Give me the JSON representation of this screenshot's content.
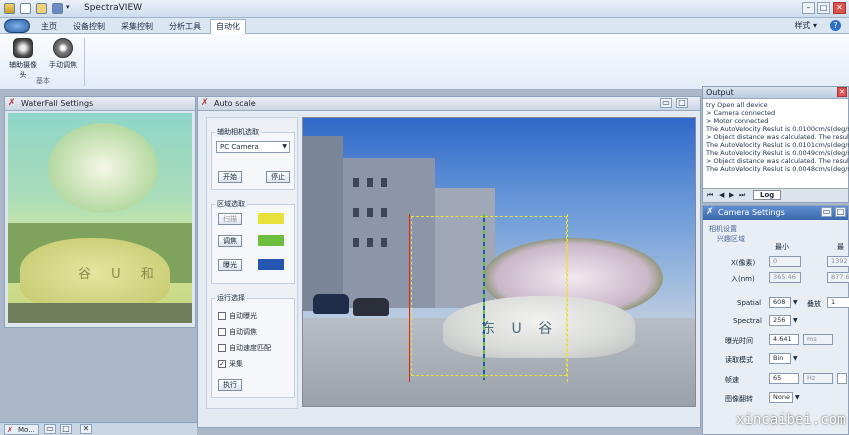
{
  "app": {
    "title": "SpectraVIEW",
    "style_label": "样式",
    "help": "?"
  },
  "ribbon": {
    "tabs": [
      {
        "label": "主页"
      },
      {
        "label": "设备控制"
      },
      {
        "label": "采集控制"
      },
      {
        "label": "分析工具"
      },
      {
        "label": "自动化"
      }
    ],
    "buttons": [
      {
        "label": "辅助摄像头",
        "icon": "camera-icon"
      },
      {
        "label": "手动调焦",
        "icon": "focus-icon"
      }
    ],
    "group_label": "基本"
  },
  "waterfall": {
    "title": "WaterFall Settings",
    "rock_text": "谷 U 和"
  },
  "autoscale": {
    "title": "Auto scale",
    "camera_group": {
      "title": "辅助相机选取",
      "selected": "PC Camera",
      "start": "开始",
      "stop": "停止"
    },
    "region_group": {
      "title": "区域选取",
      "items": [
        {
          "label": "扫描",
          "color": "#e6e23a"
        },
        {
          "label": "调焦",
          "color": "#6cbf3c"
        },
        {
          "label": "曝光",
          "color": "#2457b0"
        }
      ]
    },
    "run_group": {
      "title": "运行选择",
      "options": [
        {
          "label": "自动曝光",
          "checked": false
        },
        {
          "label": "自动调焦",
          "checked": false
        },
        {
          "label": "自动速度匹配",
          "checked": false
        },
        {
          "label": "采集",
          "checked": true
        }
      ],
      "execute": "执行"
    },
    "rock_text": "东 U 谷"
  },
  "output": {
    "title": "Output",
    "lines": [
      "try Open all device",
      ">  Camera connected",
      ">  Motor connected",
      "The AutoVelocity Reslut is 0.0100cm/s(deg/s)",
      ">  Object distance was calculated. The result is",
      "The AutoVelocity Reslut is 0.0101cm/s(deg/s)",
      "The AutoVelocity Reslut is 0.0049cm/s(deg/s)",
      ">  Object distance was calculated. The result is",
      "The AutoVelocity Reslut is 0.0048cm/s(deg/s)"
    ],
    "tab": "Log"
  },
  "camera_settings": {
    "title": "Camera Settings",
    "section": "相机设置",
    "roi": "兴趣区域",
    "col_min": "最小",
    "col_max": "最",
    "rows": [
      {
        "label": "X(像素)",
        "min": "0",
        "max": "1392"
      },
      {
        "label": "入(nm)",
        "min": "365.46",
        "max": "877.6"
      }
    ],
    "spatial_label": "Spatial",
    "spatial_value": "608",
    "binning_label": "叠放",
    "binning_value": "1",
    "spectral_label": "Spectral",
    "spectral_value": "256",
    "exposure_label": "曝光时间",
    "exposure_value": "4.641",
    "exposure_unit": "ms",
    "readout_label": "读取模式",
    "readout_value": "Bin",
    "framerate_label": "帧速",
    "framerate_value": "65",
    "framerate_unit": "Hz",
    "flip_label": "图像翻转",
    "flip_value": "None"
  },
  "statusbar": {
    "tab": "Mo..."
  },
  "watermark": "xincaibei.com"
}
